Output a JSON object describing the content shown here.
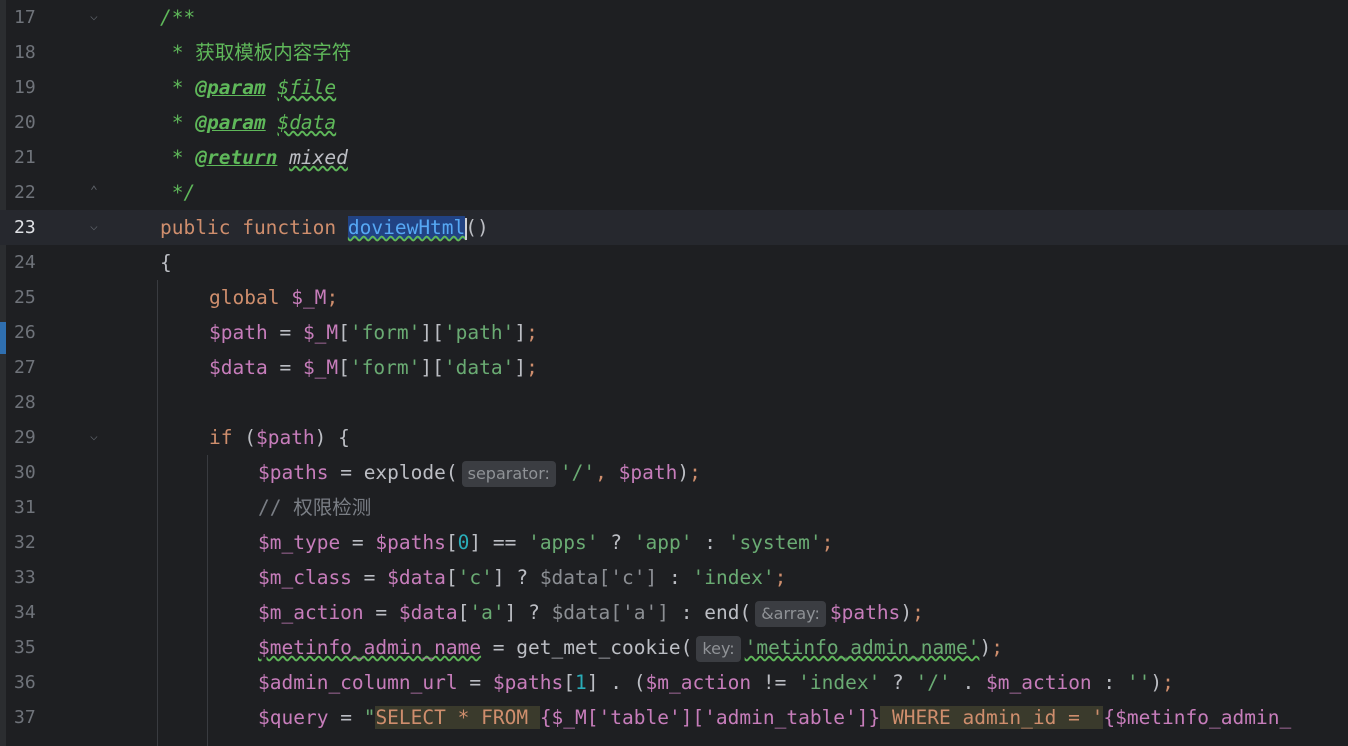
{
  "editor": {
    "current_line": 23,
    "lines": [
      {
        "n": "17",
        "text": "/**"
      },
      {
        "n": "18",
        "text": " * 获取模板内容字符"
      },
      {
        "n": "19",
        "text": " * @param $file"
      },
      {
        "n": "20",
        "text": " * @param $data"
      },
      {
        "n": "21",
        "text": " * @return mixed"
      },
      {
        "n": "22",
        "text": " */"
      },
      {
        "n": "23",
        "text": "public function doviewHtml()"
      },
      {
        "n": "24",
        "text": "{"
      },
      {
        "n": "25",
        "text": "global $_M;"
      },
      {
        "n": "26",
        "text": "$path = $_M['form']['path'];"
      },
      {
        "n": "27",
        "text": "$data = $_M['form']['data'];"
      },
      {
        "n": "28",
        "text": ""
      },
      {
        "n": "29",
        "text": "if ($path) {"
      },
      {
        "n": "30",
        "text": "$paths = explode( separator: '/', $path);"
      },
      {
        "n": "31",
        "text": "// 权限检测"
      },
      {
        "n": "32",
        "text": "$m_type = $paths[0] == 'apps' ? 'app' : 'system';"
      },
      {
        "n": "33",
        "text": "$m_class = $data['c'] ? $data['c'] : 'index';"
      },
      {
        "n": "34",
        "text": "$m_action = $data['a'] ? $data['a'] : end( &array: $paths);"
      },
      {
        "n": "35",
        "text": "$metinfo_admin_name = get_met_cookie( key: 'metinfo_admin_name');"
      },
      {
        "n": "36",
        "text": "$admin_column_url = $paths[1] . ($m_action != 'index' ? '/' . $m_action : '');"
      },
      {
        "n": "37",
        "text": "$query = \"SELECT * FROM {$_M['table']['admin_table']} WHERE admin_id = '{$metinfo_admin_"
      }
    ],
    "tokens": {
      "l17": "/**",
      "l18_star": "*",
      "l18_text": "获取模板内容字符",
      "l19_star": "*",
      "l19_tag": "@param",
      "l19_var": "$file",
      "l20_star": "*",
      "l20_tag": "@param",
      "l20_var": "$data",
      "l21_star": "*",
      "l21_tag": "@return",
      "l21_type": "mixed",
      "l22": "*/",
      "l23_kw1": "public",
      "l23_kw2": "function",
      "l23_fn": "doviewHtml",
      "l23_paren": "()",
      "l24": "{",
      "l25_kw": "global",
      "l25_var": "$_M",
      "l25_end": ";",
      "l26_var": "$path",
      "l26_eq": " = ",
      "l26_m": "$_M",
      "l26_s1": "'form'",
      "l26_s2": "'path'",
      "l27_var": "$data",
      "l27_eq": " = ",
      "l27_m": "$_M",
      "l27_s1": "'form'",
      "l27_s2": "'data'",
      "l29_kw": "if",
      "l29_var": "$path",
      "l30_var": "$paths",
      "l30_fn": "explode(",
      "l30_hint": "separator:",
      "l30_s": "'/'",
      "l30_var2": "$path",
      "l31": "// 权限检测",
      "l32_var": "$m_type",
      "l32_var2": "$paths",
      "l32_num": "0",
      "l32_s1": "'apps'",
      "l32_s2": "'app'",
      "l32_s3": "'system'",
      "l33_var": "$m_class",
      "l33_var2": "$data",
      "l33_s1": "'c'",
      "l33_var3": "$data",
      "l33_s2": "'c'",
      "l33_s3": "'index'",
      "l34_var": "$m_action",
      "l34_var2": "$data",
      "l34_s1": "'a'",
      "l34_var3": "$data",
      "l34_s2": "'a'",
      "l34_fn": "end(",
      "l34_hint": "&array:",
      "l34_var4": "$paths",
      "l35_var": "$metinfo_admin_name",
      "l35_fn": "get_met_cookie(",
      "l35_hint": "key:",
      "l35_s": "'metinfo_admin_name'",
      "l36_var": "$admin_column_url",
      "l36_var2": "$paths",
      "l36_num": "1",
      "l36_var3": "$m_action",
      "l36_s1": "'index'",
      "l36_s2": "'/'",
      "l36_var4": "$m_action",
      "l36_s3": "''",
      "l37_var": "$query",
      "l37_q": "\"",
      "l37_sql1": "SELECT * FROM ",
      "l37_interp": "{$_M['table']['admin_table']}",
      "l37_sql2": " WHERE admin_id = '",
      "l37_interp2": "{$metinfo_admin_"
    }
  }
}
